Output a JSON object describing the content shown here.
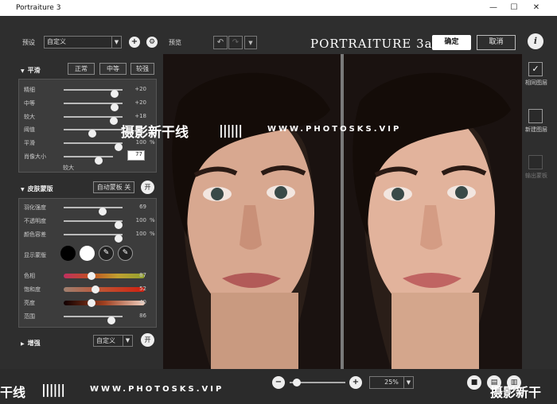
{
  "window": {
    "title": "Portraiture 3",
    "minimize": "—",
    "maximize": "☐",
    "close": "✕"
  },
  "toolbar": {
    "preset_label": "预设",
    "preset_value": "自定义",
    "preview_label": "预览",
    "brand": "PORTRAITURE 3ai",
    "ok": "确定",
    "cancel": "取消",
    "info": "i"
  },
  "smoothing": {
    "title": "平滑",
    "modes": [
      "正常",
      "中等",
      "较强"
    ],
    "sliders": [
      {
        "name": "精细",
        "value": "+20",
        "pos": 0.92
      },
      {
        "name": "中等",
        "value": "+20",
        "pos": 0.92
      },
      {
        "name": "较大",
        "value": "+18",
        "pos": 0.9
      },
      {
        "name": "阈值",
        "value": "",
        "pos": 0.49
      },
      {
        "name": "平滑",
        "value": "100",
        "unit": "%",
        "pos": 1.0
      },
      {
        "name": "肖像大小",
        "value": "77",
        "pos": 0.75
      }
    ],
    "size_caption": "较大"
  },
  "skinmask": {
    "title": "皮肤蒙版",
    "auto_label": "自动蒙板 关",
    "toggle": "开",
    "sliders": [
      {
        "name": "羽化强度",
        "value": "69",
        "pos": 0.68
      },
      {
        "name": "不透明度",
        "value": "100",
        "unit": "%",
        "pos": 1.0
      },
      {
        "name": "颜色容差",
        "value": "100",
        "unit": "%",
        "pos": 1.0
      }
    ],
    "show_mask_label": "显示蒙版",
    "color_sliders": [
      {
        "name": "色相",
        "value": "87",
        "pos": 0.33
      },
      {
        "name": "饱和度",
        "value": "52",
        "pos": 0.38
      },
      {
        "name": "亮度",
        "value": "40",
        "pos": 0.33
      },
      {
        "name": "范围",
        "value": "86",
        "pos": 0.86
      }
    ]
  },
  "enhance": {
    "title": "增强",
    "preset": "自定义",
    "toggle": "开"
  },
  "side": {
    "split": "相同图层",
    "new": "新建图层",
    "output": "输出蒙板"
  },
  "bottom": {
    "zoom": "25%",
    "minus": "−",
    "plus": "+"
  },
  "watermark": {
    "cn": "摄影新干线",
    "url": "WWW.PHOTOSKS.VIP",
    "cn_left": "干线",
    "cn_right": "摄影新干"
  },
  "colors": {
    "accent": "#ffffff",
    "panel": "#3c3c3c",
    "bg": "#2e2e2e"
  }
}
